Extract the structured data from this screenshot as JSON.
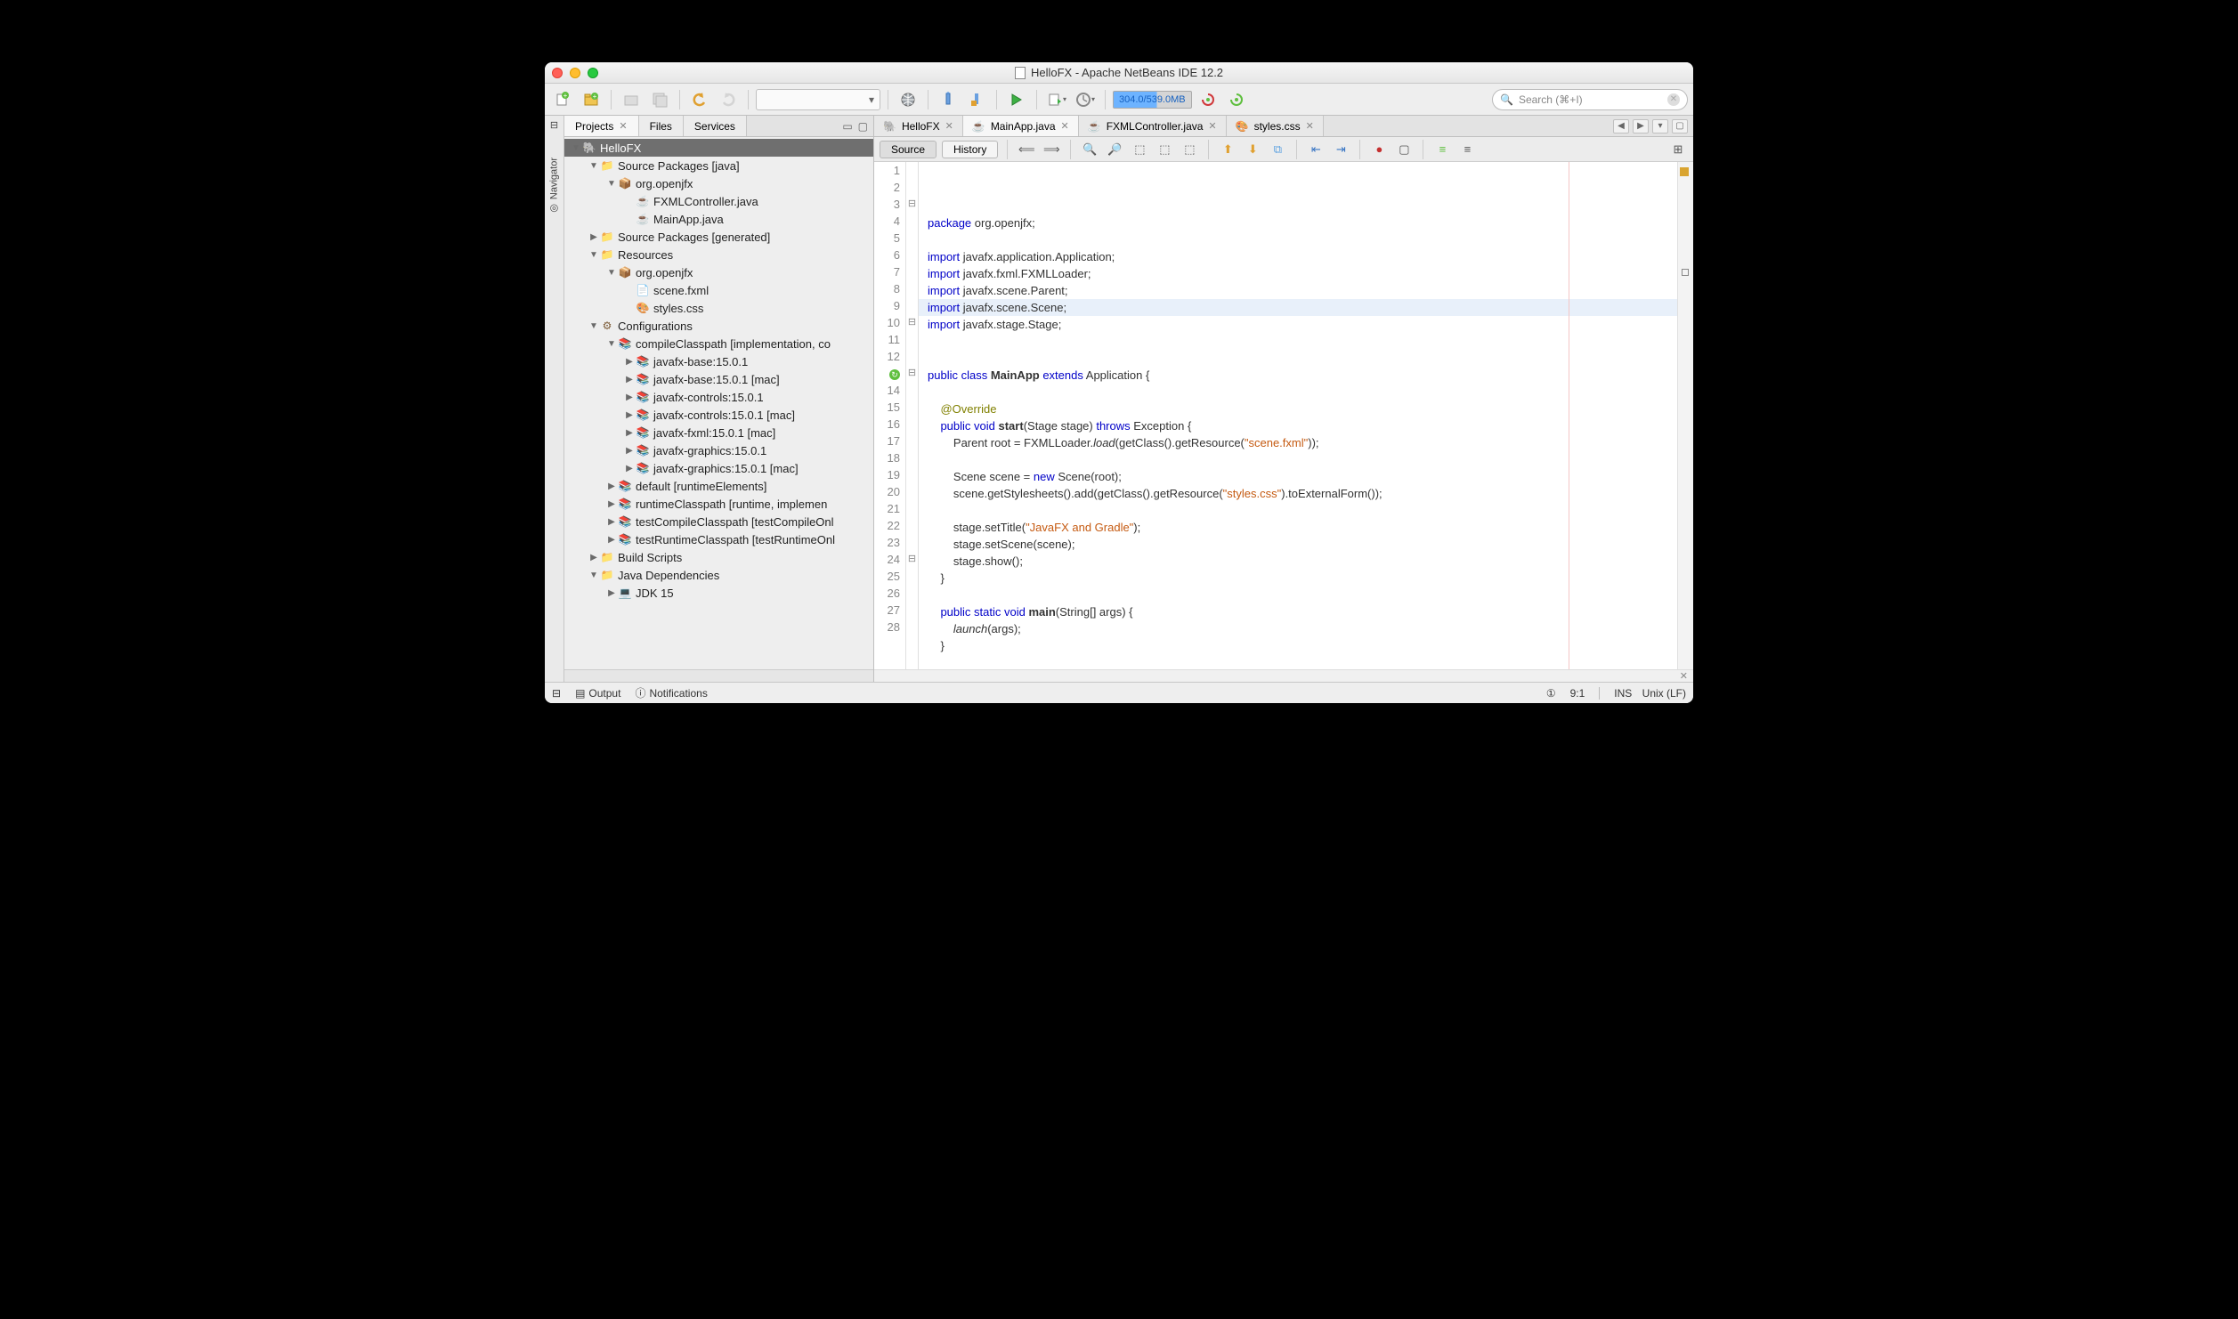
{
  "window": {
    "title": "HelloFX - Apache NetBeans IDE 12.2"
  },
  "toolbar": {
    "memory": "304.0/539.0MB",
    "search_placeholder": "Search (⌘+I)"
  },
  "sidebar": {
    "tabs": [
      {
        "label": "Projects",
        "active": true,
        "closable": true
      },
      {
        "label": "Files"
      },
      {
        "label": "Services"
      }
    ],
    "navigator_label": "Navigator",
    "tree": {
      "project": "HelloFX",
      "nodes": [
        {
          "d": 0,
          "exp": "▼",
          "icon": "elephant",
          "label": "HelloFX",
          "sel": true
        },
        {
          "d": 1,
          "exp": "▼",
          "icon": "folder",
          "label": "Source Packages [java]"
        },
        {
          "d": 2,
          "exp": "▼",
          "icon": "pkg",
          "label": "org.openjfx"
        },
        {
          "d": 3,
          "exp": "",
          "icon": "jfile",
          "label": "FXMLController.java"
        },
        {
          "d": 3,
          "exp": "",
          "icon": "jfile",
          "label": "MainApp.java"
        },
        {
          "d": 1,
          "exp": "▶",
          "icon": "folder",
          "label": "Source Packages [generated]"
        },
        {
          "d": 1,
          "exp": "▼",
          "icon": "folder",
          "label": "Resources"
        },
        {
          "d": 2,
          "exp": "▼",
          "icon": "pkg",
          "label": "org.openjfx"
        },
        {
          "d": 3,
          "exp": "",
          "icon": "xml",
          "label": "scene.fxml"
        },
        {
          "d": 3,
          "exp": "",
          "icon": "css",
          "label": "styles.css"
        },
        {
          "d": 1,
          "exp": "▼",
          "icon": "cfg",
          "label": "Configurations"
        },
        {
          "d": 2,
          "exp": "▼",
          "icon": "jar",
          "label": "compileClasspath [implementation, co"
        },
        {
          "d": 3,
          "exp": "▶",
          "icon": "jar",
          "label": "javafx-base:15.0.1"
        },
        {
          "d": 3,
          "exp": "▶",
          "icon": "jar",
          "label": "javafx-base:15.0.1 [mac]"
        },
        {
          "d": 3,
          "exp": "▶",
          "icon": "jar",
          "label": "javafx-controls:15.0.1"
        },
        {
          "d": 3,
          "exp": "▶",
          "icon": "jar",
          "label": "javafx-controls:15.0.1 [mac]"
        },
        {
          "d": 3,
          "exp": "▶",
          "icon": "jar",
          "label": "javafx-fxml:15.0.1 [mac]"
        },
        {
          "d": 3,
          "exp": "▶",
          "icon": "jar",
          "label": "javafx-graphics:15.0.1"
        },
        {
          "d": 3,
          "exp": "▶",
          "icon": "jar",
          "label": "javafx-graphics:15.0.1 [mac]"
        },
        {
          "d": 2,
          "exp": "▶",
          "icon": "jar",
          "label": "default [runtimeElements]"
        },
        {
          "d": 2,
          "exp": "▶",
          "icon": "jar",
          "label": "runtimeClasspath [runtime, implemen"
        },
        {
          "d": 2,
          "exp": "▶",
          "icon": "jar",
          "label": "testCompileClasspath [testCompileOnl"
        },
        {
          "d": 2,
          "exp": "▶",
          "icon": "jar",
          "label": "testRuntimeClasspath [testRuntimeOnl"
        },
        {
          "d": 1,
          "exp": "▶",
          "icon": "folder",
          "label": "Build Scripts"
        },
        {
          "d": 1,
          "exp": "▼",
          "icon": "folder",
          "label": "Java Dependencies"
        },
        {
          "d": 2,
          "exp": "▶",
          "icon": "jdk",
          "label": "JDK 15"
        }
      ]
    }
  },
  "editor": {
    "tabs": [
      {
        "label": "HelloFX",
        "icon": "elephant"
      },
      {
        "label": "MainApp.java",
        "icon": "jfile",
        "active": true
      },
      {
        "label": "FXMLController.java",
        "icon": "jfile"
      },
      {
        "label": "styles.css",
        "icon": "css"
      }
    ],
    "views": {
      "source": "Source",
      "history": "History"
    },
    "lines": 28,
    "code_tokens": [
      [
        {
          "t": "package ",
          "c": "kw"
        },
        {
          "t": "org.openjfx;"
        }
      ],
      [],
      [
        {
          "t": "import ",
          "c": "kw"
        },
        {
          "t": "javafx.application.Application;"
        }
      ],
      [
        {
          "t": "import ",
          "c": "kw"
        },
        {
          "t": "javafx.fxml.FXMLLoader;"
        }
      ],
      [
        {
          "t": "import ",
          "c": "kw"
        },
        {
          "t": "javafx.scene.Parent;"
        }
      ],
      [
        {
          "t": "import ",
          "c": "kw"
        },
        {
          "t": "javafx.scene.Scene;"
        }
      ],
      [
        {
          "t": "import ",
          "c": "kw"
        },
        {
          "t": "javafx.stage.Stage;"
        }
      ],
      [],
      [],
      [
        {
          "t": "public class ",
          "c": "kw"
        },
        {
          "t": "MainApp",
          "c": "bold"
        },
        {
          "t": " "
        },
        {
          "t": "extends",
          "c": "kw"
        },
        {
          "t": " Application {"
        }
      ],
      [],
      [
        {
          "t": "    @Override",
          "c": "ann"
        }
      ],
      [
        {
          "t": "    "
        },
        {
          "t": "public void ",
          "c": "kw"
        },
        {
          "t": "start",
          "c": "bold"
        },
        {
          "t": "(Stage stage) "
        },
        {
          "t": "throws",
          "c": "kw"
        },
        {
          "t": " Exception {"
        }
      ],
      [
        {
          "t": "        Parent root = FXMLLoader."
        },
        {
          "t": "load",
          "c": "ital"
        },
        {
          "t": "(getClass().getResource("
        },
        {
          "t": "\"scene.fxml\"",
          "c": "str"
        },
        {
          "t": "));"
        }
      ],
      [],
      [
        {
          "t": "        Scene scene = "
        },
        {
          "t": "new",
          "c": "kw"
        },
        {
          "t": " Scene(root);"
        }
      ],
      [
        {
          "t": "        scene.getStylesheets().add(getClass().getResource("
        },
        {
          "t": "\"styles.css\"",
          "c": "str"
        },
        {
          "t": ").toExternalForm());"
        }
      ],
      [],
      [
        {
          "t": "        stage.setTitle("
        },
        {
          "t": "\"JavaFX and Gradle\"",
          "c": "str"
        },
        {
          "t": ");"
        }
      ],
      [
        {
          "t": "        stage.setScene(scene);"
        }
      ],
      [
        {
          "t": "        stage.show();"
        }
      ],
      [
        {
          "t": "    }"
        }
      ],
      [],
      [
        {
          "t": "    "
        },
        {
          "t": "public static void ",
          "c": "kw"
        },
        {
          "t": "main",
          "c": "bold"
        },
        {
          "t": "(String[] args) {"
        }
      ],
      [
        {
          "t": "        "
        },
        {
          "t": "launch",
          "c": "ital"
        },
        {
          "t": "(args);"
        }
      ],
      [
        {
          "t": "    }"
        }
      ],
      [],
      [
        {
          "t": "}"
        }
      ]
    ],
    "fold_markers": {
      "3": "⊟",
      "10": "⊟",
      "13": "⊟",
      "24": "⊟"
    },
    "green_marker_line": 13,
    "current_line": 9
  },
  "statusbar": {
    "output": "Output",
    "notifications": "Notifications",
    "cursor": "9:1",
    "mode": "INS",
    "encoding": "Unix (LF)"
  }
}
